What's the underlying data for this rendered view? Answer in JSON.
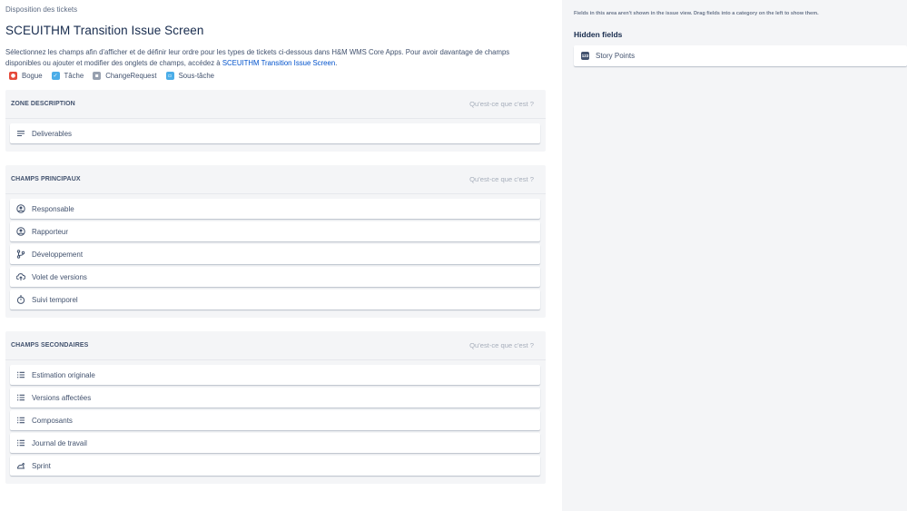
{
  "breadcrumb": "Disposition des tickets",
  "title": "SCEUITHM Transition Issue Screen",
  "description": {
    "text": "Sélectionnez les champs afin d'afficher et de définir leur ordre pour les types de tickets ci-dessous dans H&M WMS Core Apps. Pour avoir davantage de champs disponibles ou ajouter et modifier des onglets de champs, accédez à ",
    "link": "SCEUITHM Transition Issue Screen",
    "end": "."
  },
  "issue_types": [
    {
      "label": "Bogue",
      "color": "#e5493a",
      "icon": "bug-icon"
    },
    {
      "label": "Tâche",
      "color": "#4bade8",
      "icon": "task-icon"
    },
    {
      "label": "ChangeRequest",
      "color": "#97a0af",
      "icon": "change-request-icon"
    },
    {
      "label": "Sous-tâche",
      "color": "#4bade8",
      "icon": "subtask-icon"
    }
  ],
  "sections": [
    {
      "title": "ZONE DESCRIPTION",
      "help": "Qu'est-ce que c'est ?",
      "fields": [
        {
          "label": "Deliverables",
          "icon": "paragraph-icon"
        }
      ]
    },
    {
      "title": "CHAMPS PRINCIPAUX",
      "help": "Qu'est-ce que c'est ?",
      "fields": [
        {
          "label": "Responsable",
          "icon": "person-icon"
        },
        {
          "label": "Rapporteur",
          "icon": "person-icon"
        },
        {
          "label": "Développement",
          "icon": "branch-icon"
        },
        {
          "label": "Volet de versions",
          "icon": "cloud-upload-icon"
        },
        {
          "label": "Suivi temporel",
          "icon": "stopwatch-icon"
        }
      ]
    },
    {
      "title": "CHAMPS SECONDAIRES",
      "help": "Qu'est-ce que c'est ?",
      "fields": [
        {
          "label": "Estimation originale",
          "icon": "list-icon"
        },
        {
          "label": "Versions affectées",
          "icon": "list-icon"
        },
        {
          "label": "Composants",
          "icon": "list-icon"
        },
        {
          "label": "Journal de travail",
          "icon": "list-icon"
        },
        {
          "label": "Sprint",
          "icon": "sprint-icon"
        }
      ]
    }
  ],
  "side": {
    "note": "Fields in this area aren't shown in the issue view. Drag fields into a category on the left to show them.",
    "title": "Hidden fields",
    "fields": [
      {
        "label": "Story Points",
        "icon": "story-points-icon",
        "badge": "123"
      }
    ]
  }
}
